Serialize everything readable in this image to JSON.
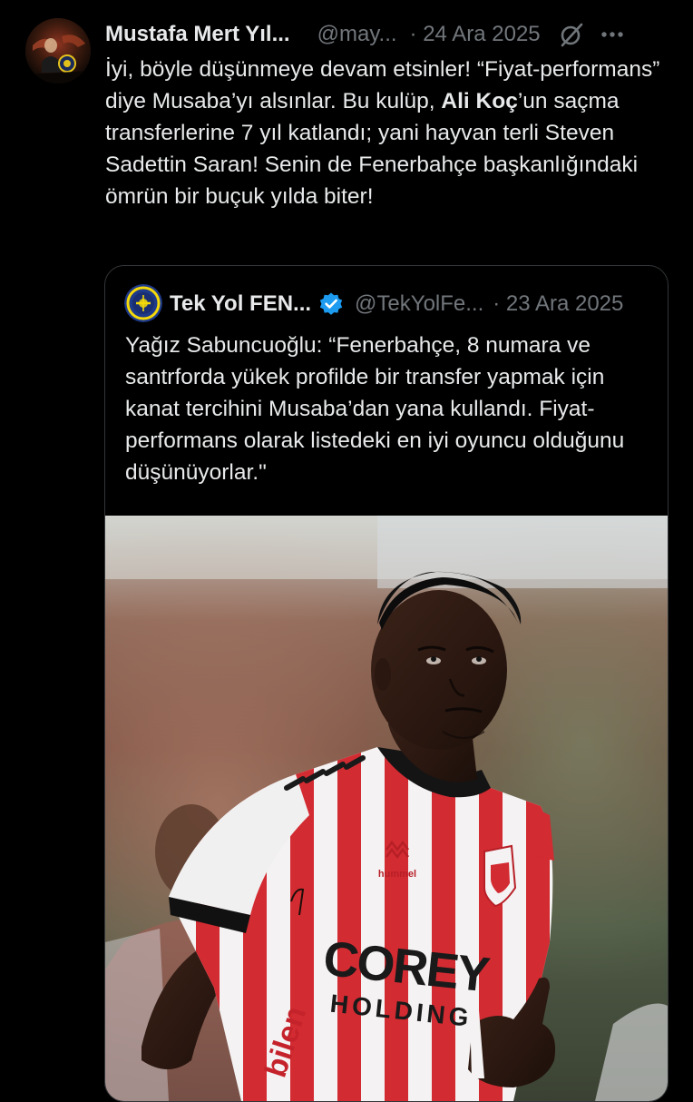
{
  "post": {
    "author_name": "Mustafa Mert Yıl...",
    "author_handle": "@may...",
    "date": "· 24 Ara 2025",
    "text_part1": "İyi, böyle düşünmeye devam etsinler! “Fiyat-performans” diye Musaba’yı alsınlar. Bu kulüp, ",
    "text_bold": "Ali Koç",
    "text_part2": "’un saçma transferlerine 7 yıl katlandı; yani hayvan terli Steven Sadettin Saran! Senin de Fenerbahçe başkanlığındaki ömrün bir buçuk yılda biter!",
    "grok_icon": "grok-icon",
    "more_icon": "more-dots-icon"
  },
  "quote": {
    "author_name": "Tek Yol FEN...",
    "verified_icon": "verified-badge-icon",
    "author_handle": "@TekYolFe...",
    "date": "· 23 Ara 2025",
    "text": "Yağız Sabuncuoğlu: “Fenerbahçe, 8 numara ve santrforda yükek profilde bir transfer yapmak için kanat tercihini Musaba’dan yana kullandı. Fiyat-performans olarak listedeki en iyi oyuncu olduğunu düşünüyorlar.\"",
    "media": {
      "jersey_sponsor": "COREY",
      "jersey_sponsor_line2": "HOLDING",
      "kit_brand": "hummel",
      "sleeve_text": "bilen"
    }
  },
  "colors": {
    "background": "#000000",
    "text_primary": "#e7e9ea",
    "text_secondary": "#71767b",
    "border": "#333639",
    "verified_blue": "#1d9bf0"
  }
}
